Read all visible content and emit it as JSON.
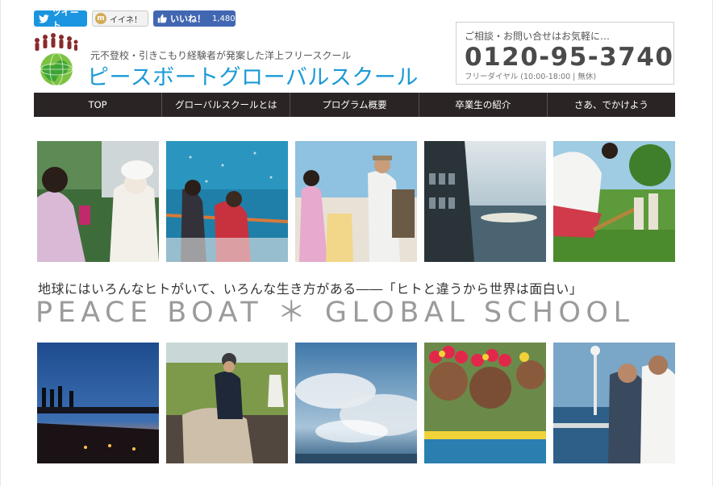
{
  "social": {
    "tweet_label": "ツイート",
    "mixi_label": "イイネ！",
    "like_label": "いいね！",
    "like_count": "1,480"
  },
  "header": {
    "tagline": "元不登校・引きこもり経験者が発案した洋上フリースクール",
    "site_name": "ピースボートグローバルスクール"
  },
  "contact": {
    "lead": "ご相談・お問い合せはお気軽に…",
    "phone": "0120-95-3740",
    "note": "フリーダイヤル (10:00-18:00 | 無休)"
  },
  "nav": {
    "items": [
      {
        "label": "TOP"
      },
      {
        "label": "グローバルスクールとは"
      },
      {
        "label": "プログラム概要"
      },
      {
        "label": "卒業生の紹介"
      },
      {
        "label": "さあ、でかけよう"
      }
    ]
  },
  "hero": {
    "slogan": "地球にはいろんなヒトがいて、いろんな生き方がある――「ヒトと違うから世界は面白い」",
    "brand": "PEACE BOAT ＊ GLOBAL SCHOOL"
  },
  "colors": {
    "accent": "#1a9ad6",
    "nav_bg": "#2b2424",
    "tweet": "#1b95e0",
    "facebook": "#4267b2"
  },
  "icons": [
    "twitter-bird-icon",
    "mixi-icon",
    "facebook-thumb-icon"
  ]
}
